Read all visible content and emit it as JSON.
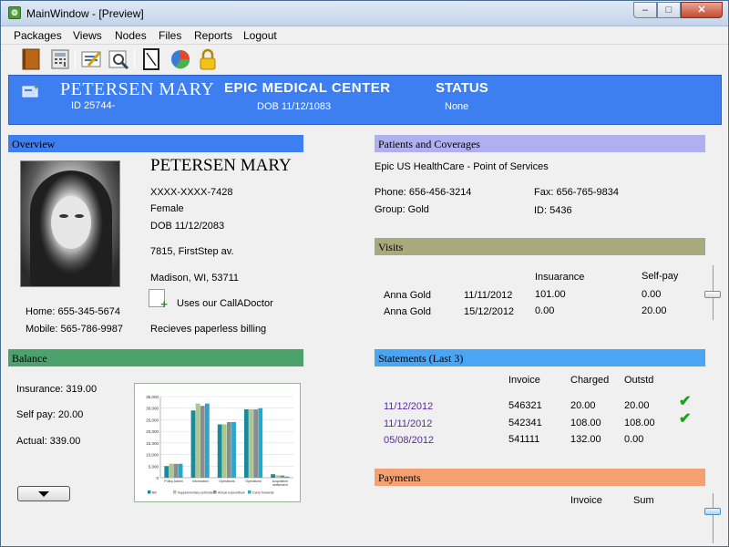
{
  "window": {
    "title": "MainWindow - [Preview]",
    "app_icon_glyph": "⚙",
    "min": "–",
    "max": "□",
    "close": "✕"
  },
  "menu": [
    "Packages",
    "Views",
    "Nodes",
    "Files",
    "Reports",
    "Logout"
  ],
  "toolbar": [
    "book-icon",
    "calculator-icon",
    "checklist-icon",
    "search-report-icon",
    "notepad-icon",
    "pie-chart-icon",
    "lock-icon"
  ],
  "header": {
    "name": "PETERSEN MARY",
    "id": "ID 25744-",
    "center": "EPIC MEDICAL CENTER",
    "dob": "DOB  11/12/1083",
    "status_label": "STATUS",
    "status_value": "None",
    "background": "#3d7ef0"
  },
  "overview": {
    "title": "Overview",
    "color": "#3d7ef0",
    "name": "PETERSEN MARY",
    "ssn": "XXXX-XXXX-7428",
    "gender": "Female",
    "dob": "DOB  11/12/2083",
    "address1": "7815, FirstStep av.",
    "address2": "Madison, WI, 53711",
    "home_phone": "Home: 655-345-5674",
    "mobile_phone": "Mobile:  565-786-9987",
    "calladoctor": "Uses our CallADoctor",
    "billing": "Recieves paperless billing"
  },
  "balance": {
    "title": "Balance",
    "color": "#4ba36b",
    "insurance": "Insurance:  319.00",
    "self_pay": "Self pay: 20.00",
    "actual": "Actual:  339.00"
  },
  "chart_data": {
    "type": "bar",
    "categories": [
      "Policy Admin",
      "Information",
      "Operations",
      "Operations",
      "Acquisition settlement"
    ],
    "series": [
      {
        "name": "Bill",
        "color": "#1a8a9a",
        "values": [
          5000,
          29000,
          23000,
          29500,
          1500
        ]
      },
      {
        "name": "Supplementary estimates",
        "color": "#a8c890",
        "values": [
          6000,
          32000,
          23000,
          29500,
          1000
        ]
      },
      {
        "name": "Actual expenditure",
        "color": "#8c8c8c",
        "values": [
          6000,
          31000,
          24000,
          29500,
          1000
        ]
      },
      {
        "name": "Carry forwards",
        "color": "#2aa6c8",
        "values": [
          6000,
          32000,
          24000,
          30000,
          500
        ]
      }
    ],
    "yticks": [
      "35,000",
      "30,000",
      "25,000",
      "20,000",
      "15,000",
      "10,000",
      "5,000",
      "0"
    ],
    "ylim": [
      0,
      35000
    ],
    "grid": true,
    "legend": "bottom"
  },
  "patients": {
    "title": "Patients and Coverages",
    "color": "#b0b0f0",
    "provider": "Epic US HealthCare - Point of Services",
    "phone": "Phone:  656-456-3214",
    "fax": "Fax:  656-765-9834",
    "group": "Group:  Gold",
    "id": "ID:  5436"
  },
  "visits": {
    "title": "Visits",
    "color": "#a9a97e",
    "col_insurance": "Insuarance",
    "col_selfpay": "Self-pay",
    "rows": [
      {
        "name": "Anna Gold",
        "date": "11/11/2012",
        "insurance": "101.00",
        "selfpay": "0.00"
      },
      {
        "name": "Anna Gold",
        "date": "15/12/2012",
        "insurance": "0.00",
        "selfpay": "20.00"
      }
    ]
  },
  "statements": {
    "title": "Statements (Last 3)",
    "color": "#4aa5f5",
    "col_invoice": "Invoice",
    "col_charged": "Charged",
    "col_outstd": "Outstd",
    "rows": [
      {
        "date": "11/12/2012",
        "invoice": "546321",
        "charged": "20.00",
        "outstd": "20.00",
        "check": "✔"
      },
      {
        "date": "11/11/2012",
        "invoice": "542341",
        "charged": "108.00",
        "outstd": "108.00",
        "check": "✔"
      },
      {
        "date": "05/08/2012",
        "invoice": "541111",
        "charged": "132.00",
        "outstd": "0.00",
        "check": ""
      }
    ]
  },
  "payments": {
    "title": "Payments",
    "color": "#f5a070",
    "col_invoice": "Invoice",
    "col_sum": "Sum"
  }
}
